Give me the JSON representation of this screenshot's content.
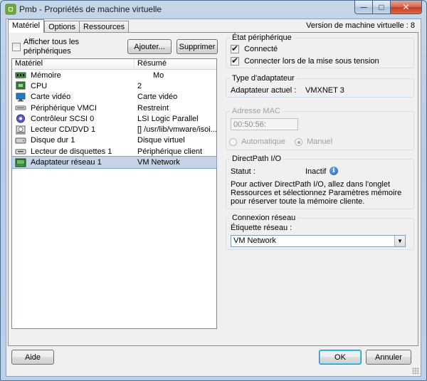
{
  "window": {
    "title": "Pmb - Propriétés de machine virtuelle",
    "controls": {
      "minimize": "—",
      "maximize": "□",
      "close": "✕"
    }
  },
  "tabs": [
    {
      "label": "Matériel",
      "active": true
    },
    {
      "label": "Options",
      "active": false
    },
    {
      "label": "Ressources",
      "active": false
    }
  ],
  "version_label": "Version de machine virtuelle : 8",
  "hardware": {
    "show_all_label": "Afficher tous les périphériques",
    "show_all_checked": false,
    "add_button": "Ajouter...",
    "remove_button": "Supprimer",
    "columns": [
      "Matériel",
      "Résumé"
    ],
    "rows": [
      {
        "icon": "memory-icon",
        "name": "Mémoire",
        "summary": "Mo"
      },
      {
        "icon": "cpu-icon",
        "name": "CPU",
        "summary": "2"
      },
      {
        "icon": "video-card-icon",
        "name": "Carte vidéo",
        "summary": "Carte vidéo"
      },
      {
        "icon": "vmci-icon",
        "name": "Périphérique VMCI",
        "summary": "Restreint"
      },
      {
        "icon": "scsi-controller-icon",
        "name": "Contrôleur SCSI 0",
        "summary": "LSI Logic Parallel"
      },
      {
        "icon": "cd-dvd-icon",
        "name": "Lecteur CD/DVD 1",
        "summary": "[] /usr/lib/vmware/isoi..."
      },
      {
        "icon": "hard-disk-icon",
        "name": "Disque dur 1",
        "summary": "Disque virtuel"
      },
      {
        "icon": "floppy-icon",
        "name": "Lecteur de disquettes 1",
        "summary": "Périphérique client"
      },
      {
        "icon": "network-adapter-icon",
        "name": "Adaptateur réseau 1",
        "summary": "VM Network",
        "selected": true
      }
    ]
  },
  "device_status": {
    "legend": "État périphérique",
    "connected_label": "Connecté",
    "connected_checked": true,
    "connect_on_power_label": "Connecter lors de la mise sous tension",
    "connect_on_power_checked": true
  },
  "adapter_type": {
    "legend": "Type d'adaptateur",
    "current_label": "Adaptateur actuel :",
    "current_value": "VMXNET 3"
  },
  "mac": {
    "legend": "Adresse MAC",
    "value": "00:50:56:",
    "automatic_label": "Automatique",
    "manual_label": "Manuel",
    "selected": "manual"
  },
  "directpath": {
    "legend": "DirectPath I/O",
    "status_label": "Statut :",
    "status_value": "Inactif",
    "info_icon_glyph": "i",
    "description": "Pour activer DirectPath I/O, allez dans l'onglet Ressources et sélectionnez Paramètres mémoire pour réserver toute la mémoire cliente."
  },
  "network_connection": {
    "legend": "Connexion réseau",
    "label": "Étiquette réseau :",
    "selected": "VM Network"
  },
  "footer": {
    "help_button": "Aide",
    "ok_button": "OK",
    "cancel_button": "Annuler"
  }
}
